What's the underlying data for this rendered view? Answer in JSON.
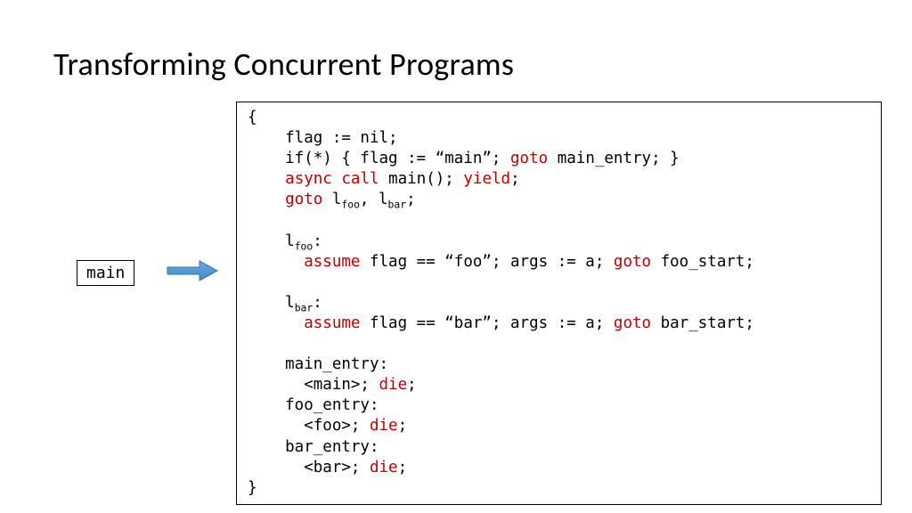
{
  "title": "Transforming Concurrent Programs",
  "label": "main",
  "kw": {
    "goto": "goto",
    "async": "async",
    "call": "call",
    "yield": "yield",
    "assume": "assume",
    "die": "die"
  },
  "code": {
    "l1": "{",
    "l2a": "    flag := nil;",
    "l3a": "    if(*) { flag := “main”; ",
    "l3b": " main_entry; }",
    "l4a": "    ",
    "l4b": " main(); ",
    "l4c": ";",
    "l5a": "    ",
    "l5b": " l",
    "l5s1": "foo",
    "l5c": ", l",
    "l5s2": "bar",
    "l5d": ";",
    "l7a": "    l",
    "l7s": "foo",
    "l7b": ":",
    "l8a": "      ",
    "l8b": " flag == “foo”; args := a; ",
    "l8c": " foo_start;",
    "l10a": "    l",
    "l10s": "bar",
    "l10b": ":",
    "l11a": "      ",
    "l11b": " flag == “bar”; args := a; ",
    "l11c": " bar_start;",
    "l13": "    main_entry:",
    "l14a": "      <main>; ",
    "l14b": ";",
    "l15": "    foo_entry:",
    "l16a": "      <foo>; ",
    "l16b": ";",
    "l17": "    bar_entry:",
    "l18a": "      <bar>; ",
    "l18b": ";",
    "l19": "}"
  }
}
